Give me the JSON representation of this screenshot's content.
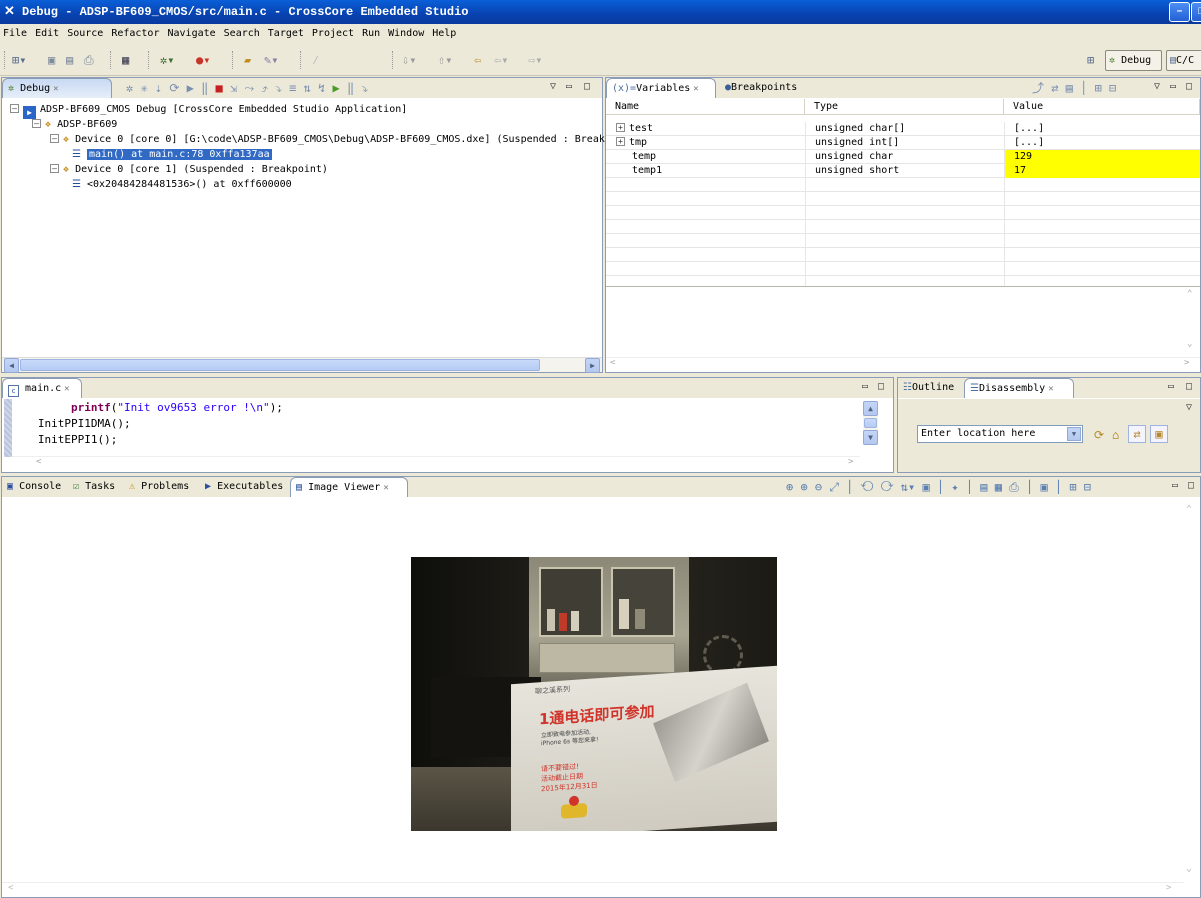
{
  "window": {
    "title": "Debug - ADSP-BF609_CMOS/src/main.c - CrossCore Embedded Studio"
  },
  "menu": [
    "File",
    "Edit",
    "Source",
    "Refactor",
    "Navigate",
    "Search",
    "Target",
    "Project",
    "Run",
    "Window",
    "Help"
  ],
  "perspectives": {
    "debug": "Debug",
    "cc": "C/C"
  },
  "debug_view": {
    "tab_label": "Debug",
    "tree": [
      "ADSP-BF609_CMOS Debug [CrossCore Embedded Studio Application]",
      "ADSP-BF609",
      "Device 0 [core 0] [G:\\code\\ADSP-BF609_CMOS\\Debug\\ADSP-BF609_CMOS.dxe] (Suspended : Breakp",
      "main() at main.c:78 0xffa137aa",
      "Device 0 [core 1] (Suspended : Breakpoint)",
      "<0x20484284481536>() at 0xff600000"
    ]
  },
  "variables_view": {
    "tab_label": "Variables",
    "breakpoints_tab": "Breakpoints",
    "headers": [
      "Name",
      "Type",
      "Value"
    ],
    "rows": [
      {
        "name": "test",
        "type": "unsigned char[]",
        "value": "[...]",
        "expandable": true,
        "changed": false
      },
      {
        "name": "tmp",
        "type": "unsigned int[]",
        "value": "[...]",
        "expandable": true,
        "changed": false
      },
      {
        "name": "temp",
        "type": "unsigned char",
        "value": "129",
        "expandable": false,
        "changed": true
      },
      {
        "name": "temp1",
        "type": "unsigned short",
        "value": "17",
        "expandable": false,
        "changed": true
      }
    ],
    "highlight_color": "#ffff00"
  },
  "editor": {
    "tab_label": "main.c",
    "lines": [
      {
        "indent": "        ",
        "fn": "printf",
        "rest_pre": "(",
        "str": "\"Init ov9653 error !\\n\"",
        "rest_post": ");"
      },
      {
        "indent": "   ",
        "text": "InitPPI1DMA();"
      },
      {
        "indent": "   ",
        "text": "InitEPPI1();"
      }
    ]
  },
  "outline_view": {
    "outline_tab": "Outline",
    "disassembly_tab": "Disassembly",
    "location_placeholder": "Enter location here"
  },
  "bottom_tabs": {
    "console": "Console",
    "tasks": "Tasks",
    "problems": "Problems",
    "executables": "Executables",
    "image_viewer": "Image Viewer"
  },
  "image_viewer": {
    "image_text": {
      "header": "聊之溪系列",
      "headline": "1通电话即可参加",
      "line1": "立即致电参加活动,",
      "line2": "iPhone 6s 等您来拿!",
      "line3": "请不要错过!",
      "line4": "活动截止日期",
      "line5": "2015年12月31日"
    }
  },
  "colors": {
    "selection": "#316ac5",
    "title_bar": "#0842b0",
    "chrome": "#ece9d8"
  }
}
